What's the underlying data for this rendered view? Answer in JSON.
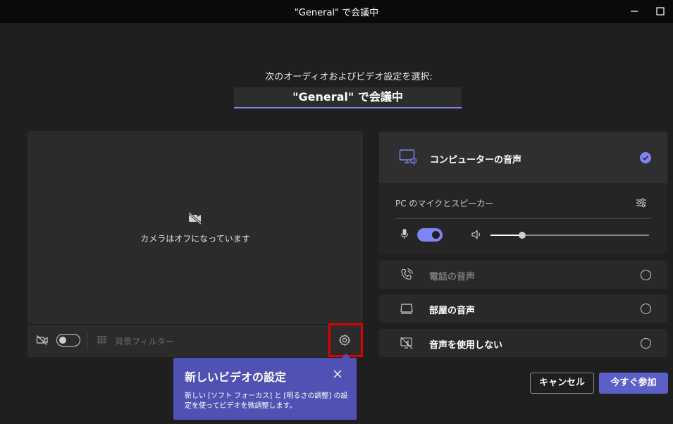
{
  "window": {
    "title": "\"General\" で会議中"
  },
  "prejoin": {
    "prompt": "次のオーディオおよびビデオ設定を選択:",
    "meeting_title": "\"General\" で会議中"
  },
  "video": {
    "camera_off_text": "カメラはオフになっています",
    "camera_toggle": "off",
    "background_filter_label": "背景フィルター"
  },
  "tooltip": {
    "title": "新しいビデオの設定",
    "body": "新しい [ソフト フォーカス] と [明るさの調整] の設定を使ってビデオを微調整します。"
  },
  "audio": {
    "computer_audio_label": "コンピューターの音声",
    "computer_audio_selected": true,
    "device_label": "PC のマイクとスピーカー",
    "mic_toggle": "on",
    "volume_fraction": 0.2,
    "phone_audio_label": "電話の音声",
    "room_audio_label": "部屋の音声",
    "no_audio_label": "音声を使用しない"
  },
  "actions": {
    "cancel_label": "キャンセル",
    "join_label": "今すぐ参加"
  },
  "colors": {
    "accent": "#7f85f5",
    "join_button": "#5b5fc7",
    "tooltip_bg": "#4f52b2",
    "highlight": "#e00000"
  }
}
